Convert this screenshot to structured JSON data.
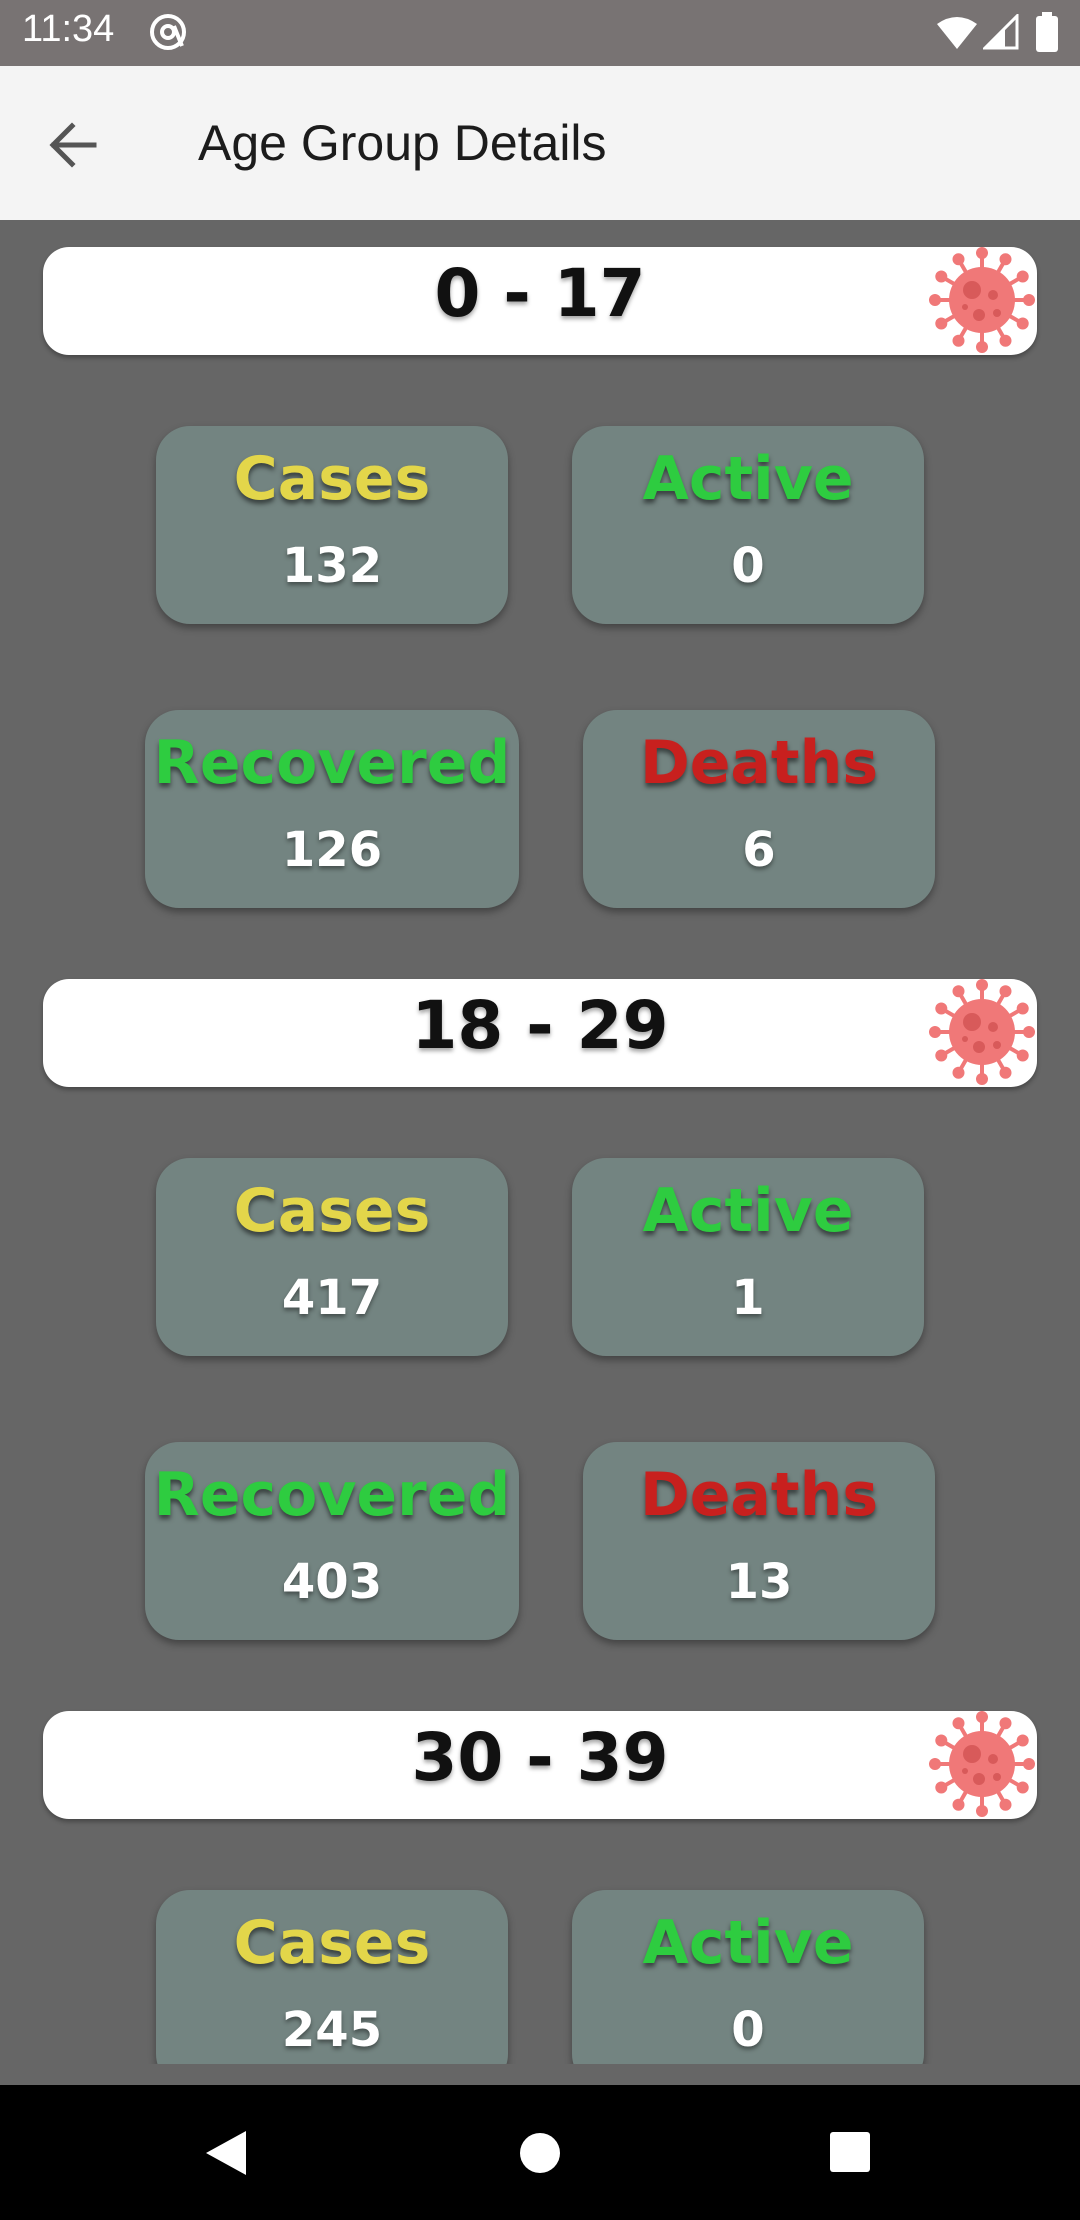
{
  "status_bar": {
    "time": "11:34"
  },
  "app_bar": {
    "title": "Age Group Details"
  },
  "labels": {
    "cases": "Cases",
    "active": "Active",
    "recovered": "Recovered",
    "deaths": "Deaths"
  },
  "groups": [
    {
      "range": "0 - 17",
      "cases": "132",
      "active": "0",
      "recovered": "126",
      "deaths": "6"
    },
    {
      "range": "18 - 29",
      "cases": "417",
      "active": "1",
      "recovered": "403",
      "deaths": "13"
    },
    {
      "range": "30 - 39",
      "cases": "245",
      "active": "0"
    }
  ],
  "colors": {
    "cases": "#e3d64a",
    "active": "#2ecc40",
    "recovered": "#2ecc40",
    "deaths": "#c8201e",
    "card_bg": "#738481",
    "page_bg": "#666666",
    "virus": "#f07878"
  },
  "icons": [
    "at-icon",
    "wifi-icon",
    "signal-icon",
    "battery-icon",
    "back-arrow-icon",
    "virus-icon",
    "nav-back-icon",
    "nav-home-icon",
    "nav-recents-icon"
  ]
}
